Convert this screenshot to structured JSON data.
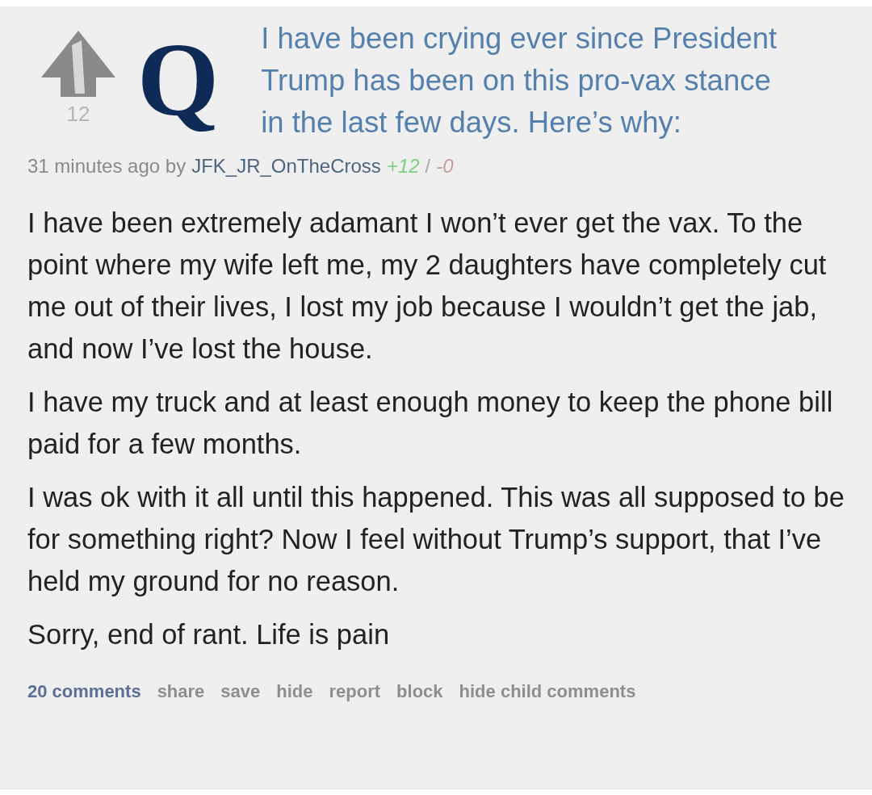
{
  "post": {
    "score": "12",
    "avatar_letter": "Q",
    "title": "I have been crying ever since President Trump has been on this pro-vax stance in the last few days. Here’s why:",
    "meta": {
      "age": "31 minutes ago by",
      "author": "JFK_JR_OnTheCross",
      "upvotes": "+12",
      "separator": "/",
      "downvotes": "-0"
    },
    "paragraphs": [
      "I have been extremely adamant I won’t ever get the vax. To the point where my wife left me, my 2 daughters have completely cut me out of their lives, I lost my job because I wouldn’t get the jab, and now I’ve lost the house.",
      "I have my truck and at least enough money to keep the phone bill paid for a few months.",
      "I was ok with it all until this happened. This was all supposed to be for something right? Now I feel without Trump’s support, that I’ve held my ground for no reason.",
      "Sorry, end of rant. Life is pain"
    ],
    "actions": [
      {
        "label": "20 comments",
        "kind": "primary"
      },
      {
        "label": "share",
        "kind": "plain"
      },
      {
        "label": "save",
        "kind": "plain"
      },
      {
        "label": "hide",
        "kind": "plain"
      },
      {
        "label": "report",
        "kind": "plain"
      },
      {
        "label": "block",
        "kind": "plain"
      },
      {
        "label": "hide child comments",
        "kind": "plain"
      }
    ]
  }
}
